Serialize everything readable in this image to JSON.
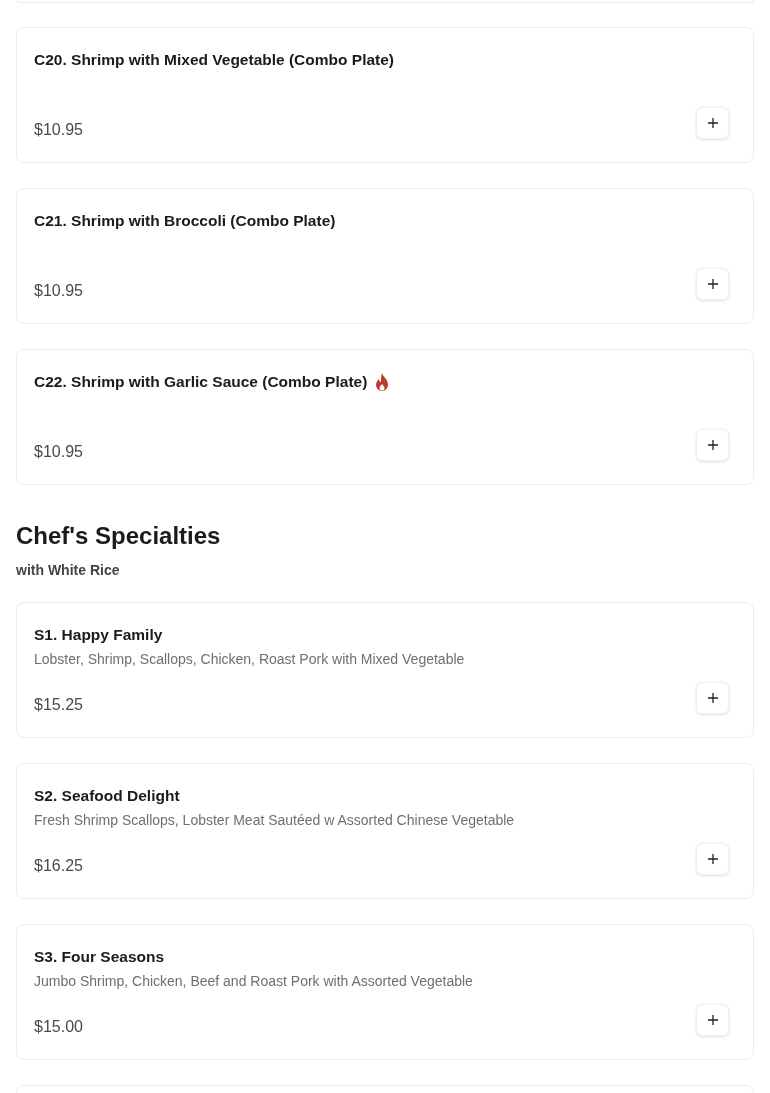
{
  "sections": [
    {
      "items": [
        {
          "name": "C20. Shrimp with Mixed Vegetable (Combo Plate)",
          "price": "$10.95",
          "spicy": false
        },
        {
          "name": "C21. Shrimp with Broccoli (Combo Plate)",
          "price": "$10.95",
          "spicy": false
        },
        {
          "name": "C22. Shrimp with Garlic Sauce (Combo Plate)",
          "price": "$10.95",
          "spicy": true
        }
      ]
    },
    {
      "title": "Chef's Specialties",
      "subtitle": "with White Rice",
      "items": [
        {
          "name": "S1. Happy Family",
          "description": "Lobster, Shrimp, Scallops, Chicken, Roast Pork with Mixed Vegetable",
          "price": "$15.25",
          "spicy": false
        },
        {
          "name": "S2. Seafood Delight",
          "description": "Fresh Shrimp Scallops, Lobster Meat Sautéed w Assorted Chinese Vegetable",
          "price": "$16.25",
          "spicy": false
        },
        {
          "name": "S3. Four Seasons",
          "description": "Jumbo Shrimp, Chicken, Beef and Roast Pork with Assorted Vegetable",
          "price": "$15.00",
          "spicy": false
        }
      ]
    }
  ]
}
